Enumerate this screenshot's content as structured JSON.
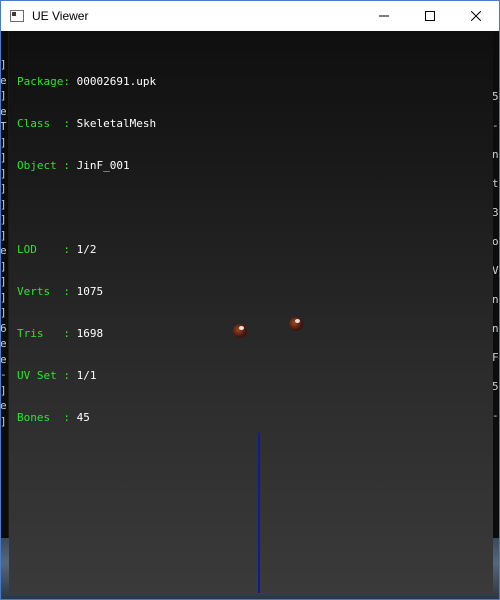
{
  "window": {
    "title": "UE Viewer",
    "icons": {
      "app": "app-window-icon",
      "minimize": "minimize-icon",
      "maximize": "maximize-icon",
      "close": "close-icon"
    }
  },
  "info": {
    "package_label": "Package: ",
    "package_value": "00002691.upk",
    "class_label": "Class  : ",
    "class_value": "SkeletalMesh",
    "object_label": "Object : ",
    "object_value": "JinF_001",
    "lod_label": "LOD    : ",
    "lod_value": "1/2",
    "verts_label": "Verts  : ",
    "verts_value": "1075",
    "tris_label": "Tris   : ",
    "tris_value": "1698",
    "uvset_label": "UV Set : ",
    "uvset_value": "1/1",
    "bones_label": "Bones  : ",
    "bones_value": "45"
  },
  "colors": {
    "label": "#33e033",
    "value": "#ffffff",
    "axis": "#0b1d9a"
  },
  "background_console": {
    "left_chars": [
      "]",
      "e",
      "]",
      "e",
      "T",
      "]",
      "]",
      "]",
      "]",
      "]",
      "]",
      "]",
      "e",
      "]",
      "]",
      "]",
      "]",
      "6",
      "e",
      "e",
      "-",
      "]",
      "e",
      "]"
    ],
    "right_chars": [
      "5",
      "-",
      "n",
      "t",
      "3",
      "o",
      "V",
      "n",
      "n",
      "F",
      "5",
      "-"
    ]
  }
}
